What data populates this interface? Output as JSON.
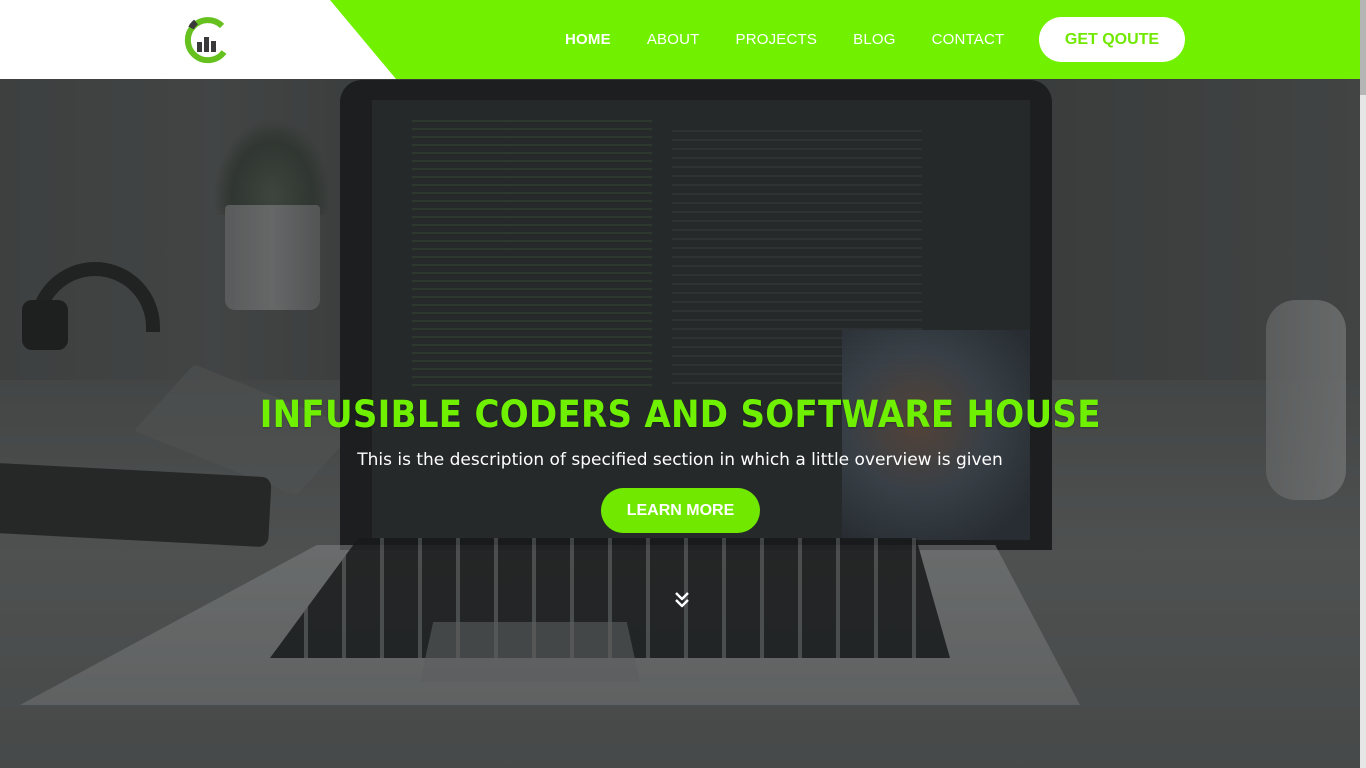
{
  "header": {
    "logo_icon": "c-bar-chart-logo",
    "nav": [
      {
        "label": "HOME",
        "active": true
      },
      {
        "label": "ABOUT",
        "active": false
      },
      {
        "label": "PROJECTS",
        "active": false
      },
      {
        "label": "BLOG",
        "active": false
      },
      {
        "label": "CONTACT",
        "active": false
      }
    ],
    "cta_label": "GET QOUTE"
  },
  "hero": {
    "title": "INFUSIBLE CODERS AND SOFTWARE HOUSE",
    "description": "This is the description of specified section in which a little overview is given",
    "button_label": "LEARN MORE",
    "scroll_icon": "double-chevron-down-icon",
    "background_icon": "laptop-desk-photo"
  },
  "colors": {
    "accent": "#71f000",
    "header_left": "#ffffff",
    "text_light": "#ffffff"
  }
}
